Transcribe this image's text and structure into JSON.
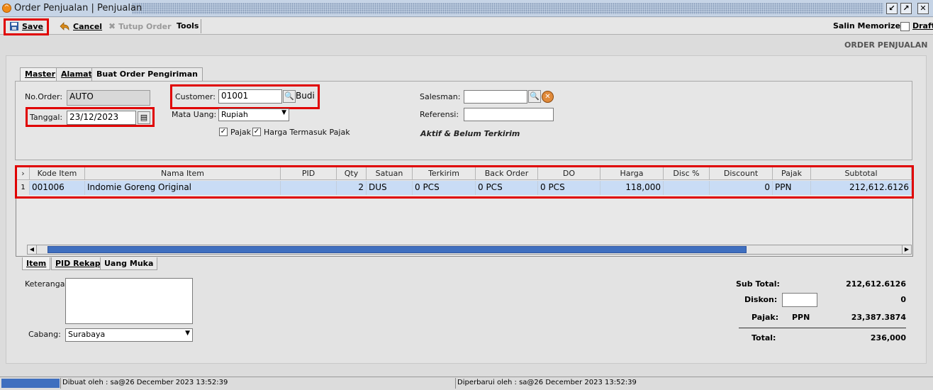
{
  "window": {
    "title": "Order Penjualan | Penjualan"
  },
  "toolbar": {
    "save": "Save",
    "cancel": "Cancel",
    "tutup_order": "Tutup Order",
    "tools": "Tools",
    "salin_memorized": "Salin Memorized",
    "draft": "Draft"
  },
  "form_title": "ORDER PENJUALAN",
  "tabs": [
    "Master",
    "Alamat",
    "Buat Order Pengiriman"
  ],
  "master": {
    "no_order_label": "No.Order:",
    "no_order": "AUTO",
    "tanggal_label": "Tanggal:",
    "tanggal": "23/12/2023",
    "customer_label": "Customer:",
    "customer_code": "01001",
    "customer_name": "Budi",
    "mata_uang_label": "Mata Uang:",
    "mata_uang": "Rupiah",
    "pajak_label": "Pajak",
    "pajak_checked": true,
    "harga_termasuk_pajak_label": "Harga Termasuk Pajak",
    "harga_termasuk_pajak_checked": true,
    "salesman_label": "Salesman:",
    "salesman": "",
    "referensi_label": "Referensi:",
    "referensi": "",
    "status": "Aktif & Belum Terkirim"
  },
  "grid": {
    "columns": [
      "Kode Item",
      "Nama Item",
      "PID",
      "Qty",
      "Satuan",
      "Terkirim",
      "Back Order",
      "DO",
      "Harga",
      "Disc %",
      "Discount",
      "Pajak",
      "Subtotal"
    ],
    "rows": [
      {
        "no": "1",
        "kode_item": "001006",
        "nama_item": "Indomie Goreng Original",
        "pid": "",
        "qty": "2",
        "satuan": "DUS",
        "terkirim": "0 PCS",
        "back_order": "0 PCS",
        "do": "0 PCS",
        "harga": "118,000",
        "disc_pct": "",
        "discount": "0",
        "pajak": "PPN",
        "subtotal": "212,612.6126"
      }
    ]
  },
  "bottom_tabs": [
    "Item",
    "PID Rekap",
    "Uang Muka"
  ],
  "footer": {
    "keterangan_label": "Keterangan:",
    "keterangan": "",
    "cabang_label": "Cabang:",
    "cabang": "Surabaya"
  },
  "summary": {
    "sub_total_label": "Sub Total:",
    "sub_total": "212,612.6126",
    "diskon_label": "Diskon:",
    "diskon_input": "",
    "diskon": "0",
    "pajak_label": "Pajak:",
    "pajak_type": "PPN",
    "pajak": "23,387.3874",
    "total_label": "Total:",
    "total": "236,000"
  },
  "status_bar": {
    "dibuat": "Dibuat oleh : sa@26 December 2023  13:52:39",
    "diperbarui": "Diperbarui oleh : sa@26 December 2023  13:52:39"
  },
  "colors": {
    "highlight": "#e00000",
    "selected_row": "#c9dcf5",
    "scroll_thumb": "#3f6fbf"
  }
}
